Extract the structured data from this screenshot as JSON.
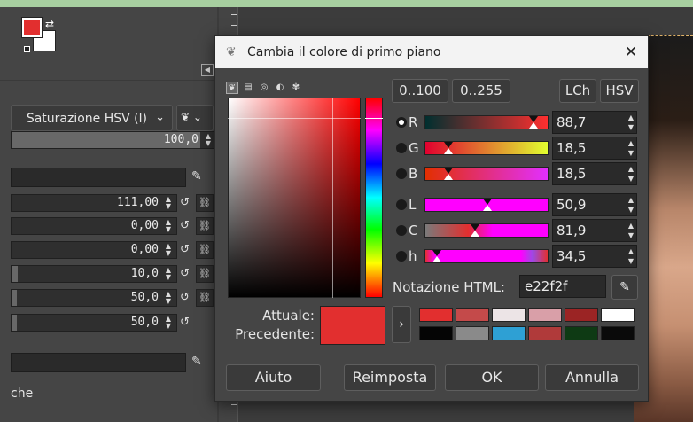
{
  "left_panel": {
    "mode_label": "Saturazione HSV (l)",
    "opacity_value": "100,0",
    "rows": [
      "111,00",
      "0,00",
      "0,00",
      "10,0",
      "50,0",
      "50,0"
    ],
    "bottom_label": "che"
  },
  "dialog": {
    "title": "Cambia il colore di primo piano",
    "close_glyph": "✕",
    "buttons_range": [
      "0..100",
      "0..255"
    ],
    "buttons_model": [
      "LCh",
      "HSV"
    ],
    "channels": [
      {
        "label": "R",
        "value": "88,7",
        "selected": true,
        "marker": 0.887
      },
      {
        "label": "G",
        "value": "18,5",
        "selected": false,
        "marker": 0.185
      },
      {
        "label": "B",
        "value": "18,5",
        "selected": false,
        "marker": 0.185
      },
      {
        "label": "L",
        "value": "50,9",
        "selected": false,
        "marker": 0.509
      },
      {
        "label": "C",
        "value": "81,9",
        "selected": false,
        "marker": 0.409
      },
      {
        "label": "h",
        "value": "34,5",
        "selected": false,
        "marker": 0.096
      }
    ],
    "html_label": "Notazione HTML:",
    "html_value": "e22f2f",
    "current_label": "Attuale:",
    "previous_label": "Precedente:",
    "current_color": "#e22f2f",
    "history": [
      "#e22f2f",
      "#c44a4a",
      "#ece4e6",
      "#d99fa8",
      "#9b2424",
      "#ffffff",
      "#050505",
      "#8a8a8a",
      "#2ea0d4",
      "#b03a3a",
      "#0e3a14",
      "#0a0a0a"
    ],
    "bottom_buttons": [
      "Aiuto",
      "Reimposta",
      "OK",
      "Annulla"
    ]
  },
  "icons": {
    "swap": "swap-colors-icon",
    "edit": "edit-icon",
    "undo": "reset-icon",
    "chain": "chain-icon",
    "picker": "color-picker-icon"
  }
}
